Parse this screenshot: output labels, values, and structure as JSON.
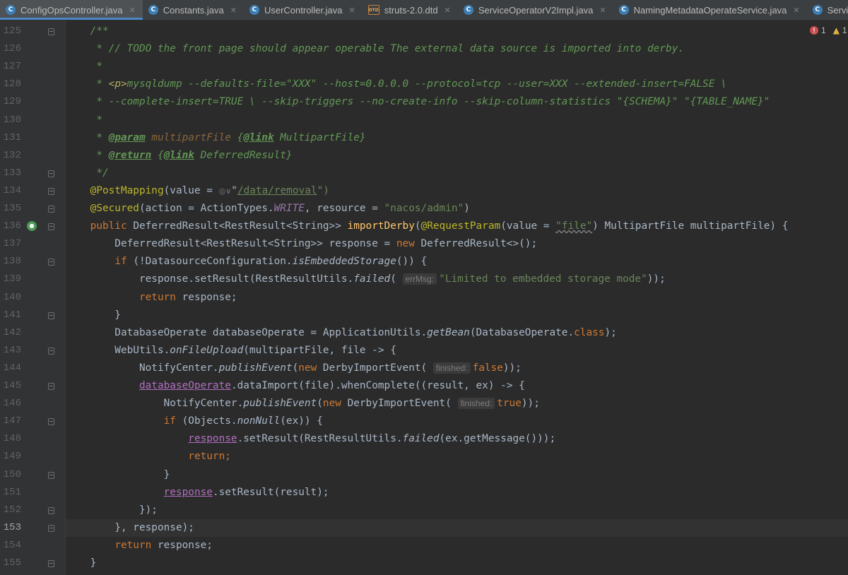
{
  "tabs": [
    {
      "label": "ConfigOpsController.java",
      "icon": "java-class-icon",
      "active": true
    },
    {
      "label": "Constants.java",
      "icon": "java-class-icon",
      "active": false
    },
    {
      "label": "UserController.java",
      "icon": "java-class-icon",
      "active": false
    },
    {
      "label": "struts-2.0.dtd",
      "icon": "dtd-file-icon",
      "active": false
    },
    {
      "label": "ServiceOperatorV2Impl.java",
      "icon": "java-class-icon",
      "active": false
    },
    {
      "label": "NamingMetadataOperateService.java",
      "icon": "java-class-icon",
      "active": false
    },
    {
      "label": "Service.java",
      "icon": "java-class-icon",
      "active": false
    }
  ],
  "inspection": {
    "errors": "1",
    "warnings": "1"
  },
  "editor": {
    "current_line": 153,
    "lines": [
      {
        "n": "125",
        "fold": true,
        "segs": [
          [
            "    ",
            ""
          ],
          [
            "/**",
            "doc"
          ]
        ]
      },
      {
        "n": "126",
        "fold": false,
        "segs": [
          [
            "     * // TODO the front page should appear operable The external data source is imported into derby.",
            "doc"
          ]
        ]
      },
      {
        "n": "127",
        "fold": false,
        "segs": [
          [
            "     *",
            "doc"
          ]
        ]
      },
      {
        "n": "128",
        "fold": false,
        "segs": [
          [
            "     * ",
            "doc"
          ],
          [
            "<p>",
            "dhtml"
          ],
          [
            "mysqldump --defaults-file=\"XXX\" --host=0.0.0.0 --protocol=tcp --user=XXX --extended-insert=FALSE \\",
            "doc"
          ]
        ]
      },
      {
        "n": "129",
        "fold": false,
        "segs": [
          [
            "     * --complete-insert=TRUE \\ --skip-triggers --no-create-info --skip-column-statistics \"{SCHEMA}\" \"{TABLE_NAME}\"",
            "doc"
          ]
        ]
      },
      {
        "n": "130",
        "fold": false,
        "segs": [
          [
            "     *",
            "doc"
          ]
        ]
      },
      {
        "n": "131",
        "fold": false,
        "segs": [
          [
            "     * ",
            "doc"
          ],
          [
            "@param",
            "dtag"
          ],
          [
            " ",
            "doc"
          ],
          [
            "multipartFile",
            "dname"
          ],
          [
            " {",
            "doc"
          ],
          [
            "@link",
            "dtag"
          ],
          [
            " MultipartFile}",
            "doc"
          ]
        ]
      },
      {
        "n": "132",
        "fold": false,
        "segs": [
          [
            "     * ",
            "doc"
          ],
          [
            "@return",
            "dtag"
          ],
          [
            " {",
            "doc"
          ],
          [
            "@link",
            "dtag"
          ],
          [
            " DeferredResult}",
            "doc"
          ]
        ]
      },
      {
        "n": "133",
        "fold": true,
        "segs": [
          [
            "     */",
            "doc"
          ]
        ]
      },
      {
        "n": "134",
        "fold": true,
        "segs": [
          [
            "    ",
            ""
          ],
          [
            "@PostMapping",
            "ann"
          ],
          [
            "(value = ",
            ""
          ],
          [
            "◎∨",
            "gicon"
          ],
          [
            "\"",
            ""
          ],
          [
            "/data/removal",
            "str link"
          ],
          [
            "\")",
            "str"
          ]
        ]
      },
      {
        "n": "135",
        "fold": true,
        "segs": [
          [
            "    ",
            ""
          ],
          [
            "@Secured",
            "ann"
          ],
          [
            "(action = ActionTypes.",
            ""
          ],
          [
            "WRITE",
            "fld"
          ],
          [
            ", resource = ",
            ""
          ],
          [
            "\"nacos/admin\"",
            "str"
          ],
          [
            ")",
            ""
          ]
        ]
      },
      {
        "n": "136",
        "fold": true,
        "run": true,
        "segs": [
          [
            "    ",
            ""
          ],
          [
            "public ",
            "kw"
          ],
          [
            "DeferredResult<RestResult<String>> ",
            ""
          ],
          [
            "importDerby",
            "fn"
          ],
          [
            "(",
            ""
          ],
          [
            "@RequestParam",
            "ann"
          ],
          [
            "(value = ",
            ""
          ],
          [
            "\"file\"",
            "str sq"
          ],
          [
            ") MultipartFile multipartFile) {",
            ""
          ]
        ]
      },
      {
        "n": "137",
        "fold": false,
        "segs": [
          [
            "        DeferredResult<RestResult<String>> response = ",
            ""
          ],
          [
            "new ",
            "kw"
          ],
          [
            "DeferredResult<>();",
            ""
          ]
        ]
      },
      {
        "n": "138",
        "fold": true,
        "segs": [
          [
            "        ",
            ""
          ],
          [
            "if ",
            "kw"
          ],
          [
            "(!DatasourceConfiguration.",
            ""
          ],
          [
            "isEmbeddedStorage",
            "st"
          ],
          [
            "()) {",
            ""
          ]
        ]
      },
      {
        "n": "139",
        "fold": false,
        "segs": [
          [
            "            response.setResult(RestResultUtils.",
            ""
          ],
          [
            "failed",
            "st"
          ],
          [
            "( ",
            ""
          ],
          [
            "errMsg:",
            "hint"
          ],
          [
            "\"Limited to embedded storage mode\"",
            "str"
          ],
          [
            "));",
            ""
          ]
        ]
      },
      {
        "n": "140",
        "fold": false,
        "segs": [
          [
            "            ",
            ""
          ],
          [
            "return ",
            "kw"
          ],
          [
            "response;",
            ""
          ]
        ]
      },
      {
        "n": "141",
        "fold": true,
        "segs": [
          [
            "        }",
            ""
          ]
        ]
      },
      {
        "n": "142",
        "fold": false,
        "segs": [
          [
            "        DatabaseOperate databaseOperate = ApplicationUtils.",
            ""
          ],
          [
            "getBean",
            "st"
          ],
          [
            "(DatabaseOperate.",
            ""
          ],
          [
            "class",
            "kw"
          ],
          [
            ");",
            ""
          ]
        ]
      },
      {
        "n": "143",
        "fold": true,
        "segs": [
          [
            "        WebUtils.",
            ""
          ],
          [
            "onFileUpload",
            "st"
          ],
          [
            "(multipartFile, file -> {",
            ""
          ]
        ]
      },
      {
        "n": "144",
        "fold": false,
        "segs": [
          [
            "            NotifyCenter.",
            ""
          ],
          [
            "publishEvent",
            "st"
          ],
          [
            "(",
            ""
          ],
          [
            "new ",
            "kw"
          ],
          [
            "DerbyImportEvent( ",
            ""
          ],
          [
            "finished:",
            "hint"
          ],
          [
            "false",
            "kw"
          ],
          [
            "));",
            ""
          ]
        ]
      },
      {
        "n": "145",
        "fold": true,
        "segs": [
          [
            "            ",
            ""
          ],
          [
            "databaseOperate",
            "uline"
          ],
          [
            ".dataImport(file).whenComplete((result, ex) -> {",
            ""
          ]
        ]
      },
      {
        "n": "146",
        "fold": false,
        "segs": [
          [
            "                NotifyCenter.",
            ""
          ],
          [
            "publishEvent",
            "st"
          ],
          [
            "(",
            ""
          ],
          [
            "new ",
            "kw"
          ],
          [
            "DerbyImportEvent( ",
            ""
          ],
          [
            "finished:",
            "hint"
          ],
          [
            "true",
            "kw"
          ],
          [
            "));",
            ""
          ]
        ]
      },
      {
        "n": "147",
        "fold": true,
        "segs": [
          [
            "                ",
            ""
          ],
          [
            "if ",
            "kw"
          ],
          [
            "(Objects.",
            ""
          ],
          [
            "nonNull",
            "st"
          ],
          [
            "(ex)) {",
            ""
          ]
        ]
      },
      {
        "n": "148",
        "fold": false,
        "segs": [
          [
            "                    ",
            ""
          ],
          [
            "response",
            "uline"
          ],
          [
            ".setResult(RestResultUtils.",
            ""
          ],
          [
            "failed",
            "st"
          ],
          [
            "(ex.getMessage()));",
            ""
          ]
        ]
      },
      {
        "n": "149",
        "fold": false,
        "segs": [
          [
            "                    ",
            ""
          ],
          [
            "return",
            "kw"
          ],
          [
            ";",
            "kw"
          ]
        ]
      },
      {
        "n": "150",
        "fold": true,
        "segs": [
          [
            "                }",
            ""
          ]
        ]
      },
      {
        "n": "151",
        "fold": false,
        "segs": [
          [
            "                ",
            ""
          ],
          [
            "response",
            "uline"
          ],
          [
            ".setResult(result);",
            ""
          ]
        ]
      },
      {
        "n": "152",
        "fold": true,
        "segs": [
          [
            "            });",
            ""
          ]
        ]
      },
      {
        "n": "153",
        "fold": true,
        "segs": [
          [
            "        }, response);",
            ""
          ]
        ]
      },
      {
        "n": "154",
        "fold": false,
        "segs": [
          [
            "        ",
            ""
          ],
          [
            "return ",
            "kw"
          ],
          [
            "response;",
            ""
          ]
        ]
      },
      {
        "n": "155",
        "fold": true,
        "segs": [
          [
            "    }",
            ""
          ]
        ]
      }
    ]
  }
}
